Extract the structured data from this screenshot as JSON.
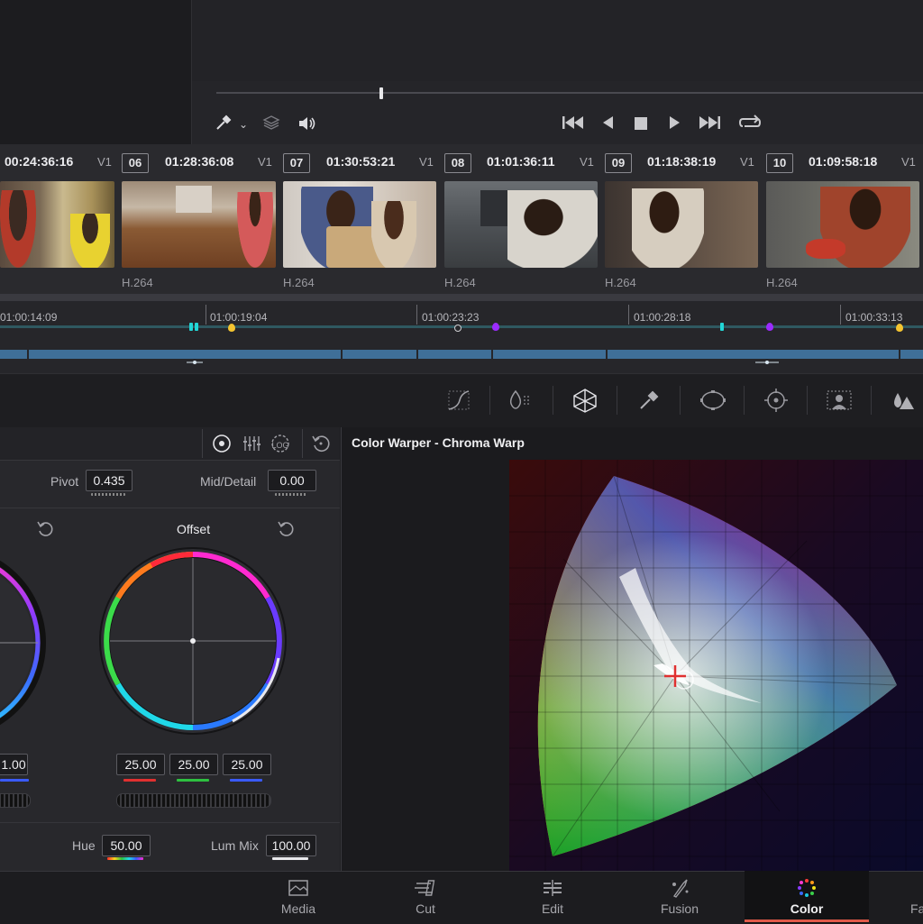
{
  "clips": [
    {
      "num": "",
      "timecode": "00:24:36:16",
      "track": "V1",
      "codec": ""
    },
    {
      "num": "06",
      "timecode": "01:28:36:08",
      "track": "V1",
      "codec": "H.264"
    },
    {
      "num": "07",
      "timecode": "01:30:53:21",
      "track": "V1",
      "codec": "H.264"
    },
    {
      "num": "08",
      "timecode": "01:01:36:11",
      "track": "V1",
      "codec": "H.264"
    },
    {
      "num": "09",
      "timecode": "01:18:38:19",
      "track": "V1",
      "codec": "H.264"
    },
    {
      "num": "10",
      "timecode": "01:09:58:18",
      "track": "V1",
      "codec": "H.264"
    }
  ],
  "ruler": [
    "01:00:14:09",
    "01:00:19:04",
    "01:00:23:23",
    "01:00:28:18",
    "01:00:33:13"
  ],
  "primaries": {
    "pivot_label": "Pivot",
    "pivot_value": "0.435",
    "middetail_label": "Mid/Detail",
    "middetail_value": "0.00",
    "offset_label": "Offset",
    "left_wheel_value": "1.00",
    "offset_values": [
      "25.00",
      "25.00",
      "25.00"
    ],
    "hue_label": "Hue",
    "hue_value": "50.00",
    "lummix_label": "Lum Mix",
    "lummix_value": "100.00"
  },
  "warper": {
    "title": "Color Warper - Chroma Warp"
  },
  "nav": [
    {
      "label": "Media",
      "icon": "media-icon"
    },
    {
      "label": "Cut",
      "icon": "cut-icon"
    },
    {
      "label": "Edit",
      "icon": "edit-icon"
    },
    {
      "label": "Fusion",
      "icon": "fusion-icon"
    },
    {
      "label": "Color",
      "icon": "color-icon",
      "active": true
    },
    {
      "label": "Fa",
      "icon": "fairlight-icon"
    }
  ],
  "colors": {
    "accent_active": "#e05a4a",
    "clip_bar": "#3f6f98",
    "marker_purple": "#9b2bff",
    "marker_yellow": "#f4c430",
    "marker_cyan": "#22d6d6"
  }
}
